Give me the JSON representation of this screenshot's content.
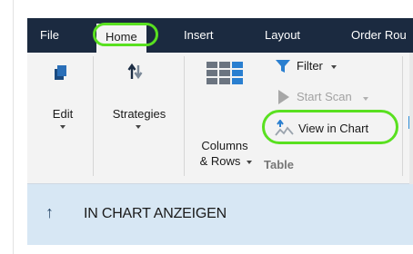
{
  "tabs": [
    {
      "label": "File"
    },
    {
      "label": "Home"
    },
    {
      "label": "Insert"
    },
    {
      "label": "Layout"
    },
    {
      "label": "Order Rou"
    }
  ],
  "ribbon": {
    "edit_label": "Edit",
    "strategies_label": "Strategies",
    "columns_label_1": "Columns",
    "columns_label_2": "& Rows",
    "filter_label": "Filter",
    "start_scan_label": "Start Scan",
    "view_in_chart_label": "View in Chart",
    "group_table_label": "Table"
  },
  "bottom": {
    "arrow_symbol": "↑",
    "text": "IN CHART ANZEIGEN"
  },
  "colors": {
    "tabbar": "#1b2a40",
    "ribbon": "#f3f3f3",
    "highlight": "#59e020",
    "accent_blue": "#2f8fd8",
    "bottom_bg": "#d7e7f4"
  },
  "icons": [
    "edit-icon",
    "strategies-icon",
    "columns-rows-icon",
    "filter-icon",
    "start-scan-icon",
    "view-in-chart-icon",
    "up-arrow-icon"
  ]
}
